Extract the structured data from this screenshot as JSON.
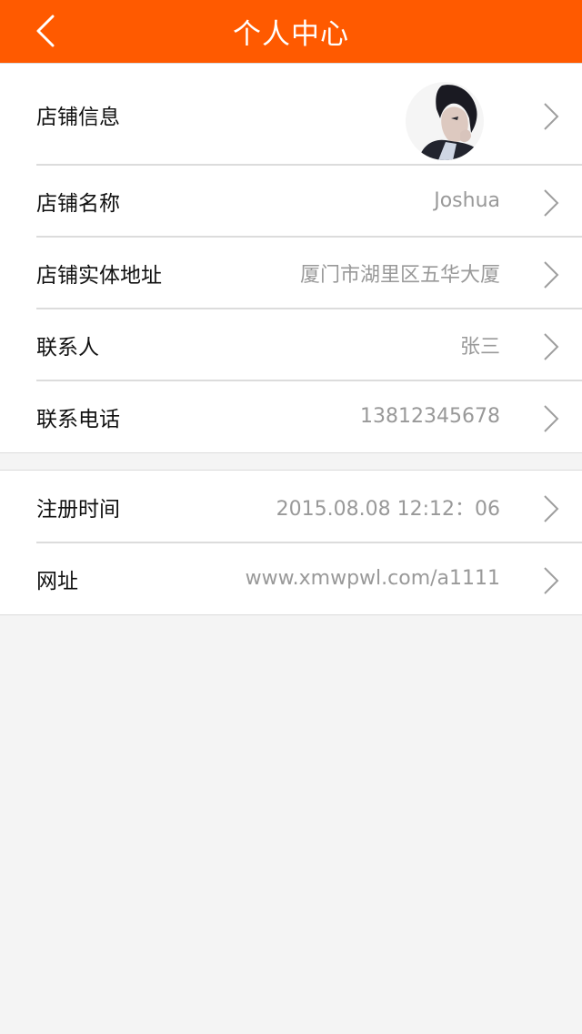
{
  "header": {
    "title": "个人中心",
    "back_icon": "chevron-left-icon",
    "color": "#ff5a00"
  },
  "group1": {
    "rows": [
      {
        "label": "店铺信息",
        "value": "",
        "avatar": "user-avatar-photo"
      },
      {
        "label": "店铺名称",
        "value": "Joshua"
      },
      {
        "label": "店铺实体地址",
        "value": "厦门市湖里区五华大厦"
      },
      {
        "label": "联系人",
        "value": "张三"
      },
      {
        "label": "联系电话",
        "value": "13812345678"
      }
    ]
  },
  "group2": {
    "rows": [
      {
        "label": "注册时间",
        "value": "2015.08.08 12:12：06"
      },
      {
        "label": "网址",
        "value": "www.xmwpwl.com/a1111"
      }
    ]
  },
  "icons": {
    "row_chevron": "chevron-right-icon"
  }
}
